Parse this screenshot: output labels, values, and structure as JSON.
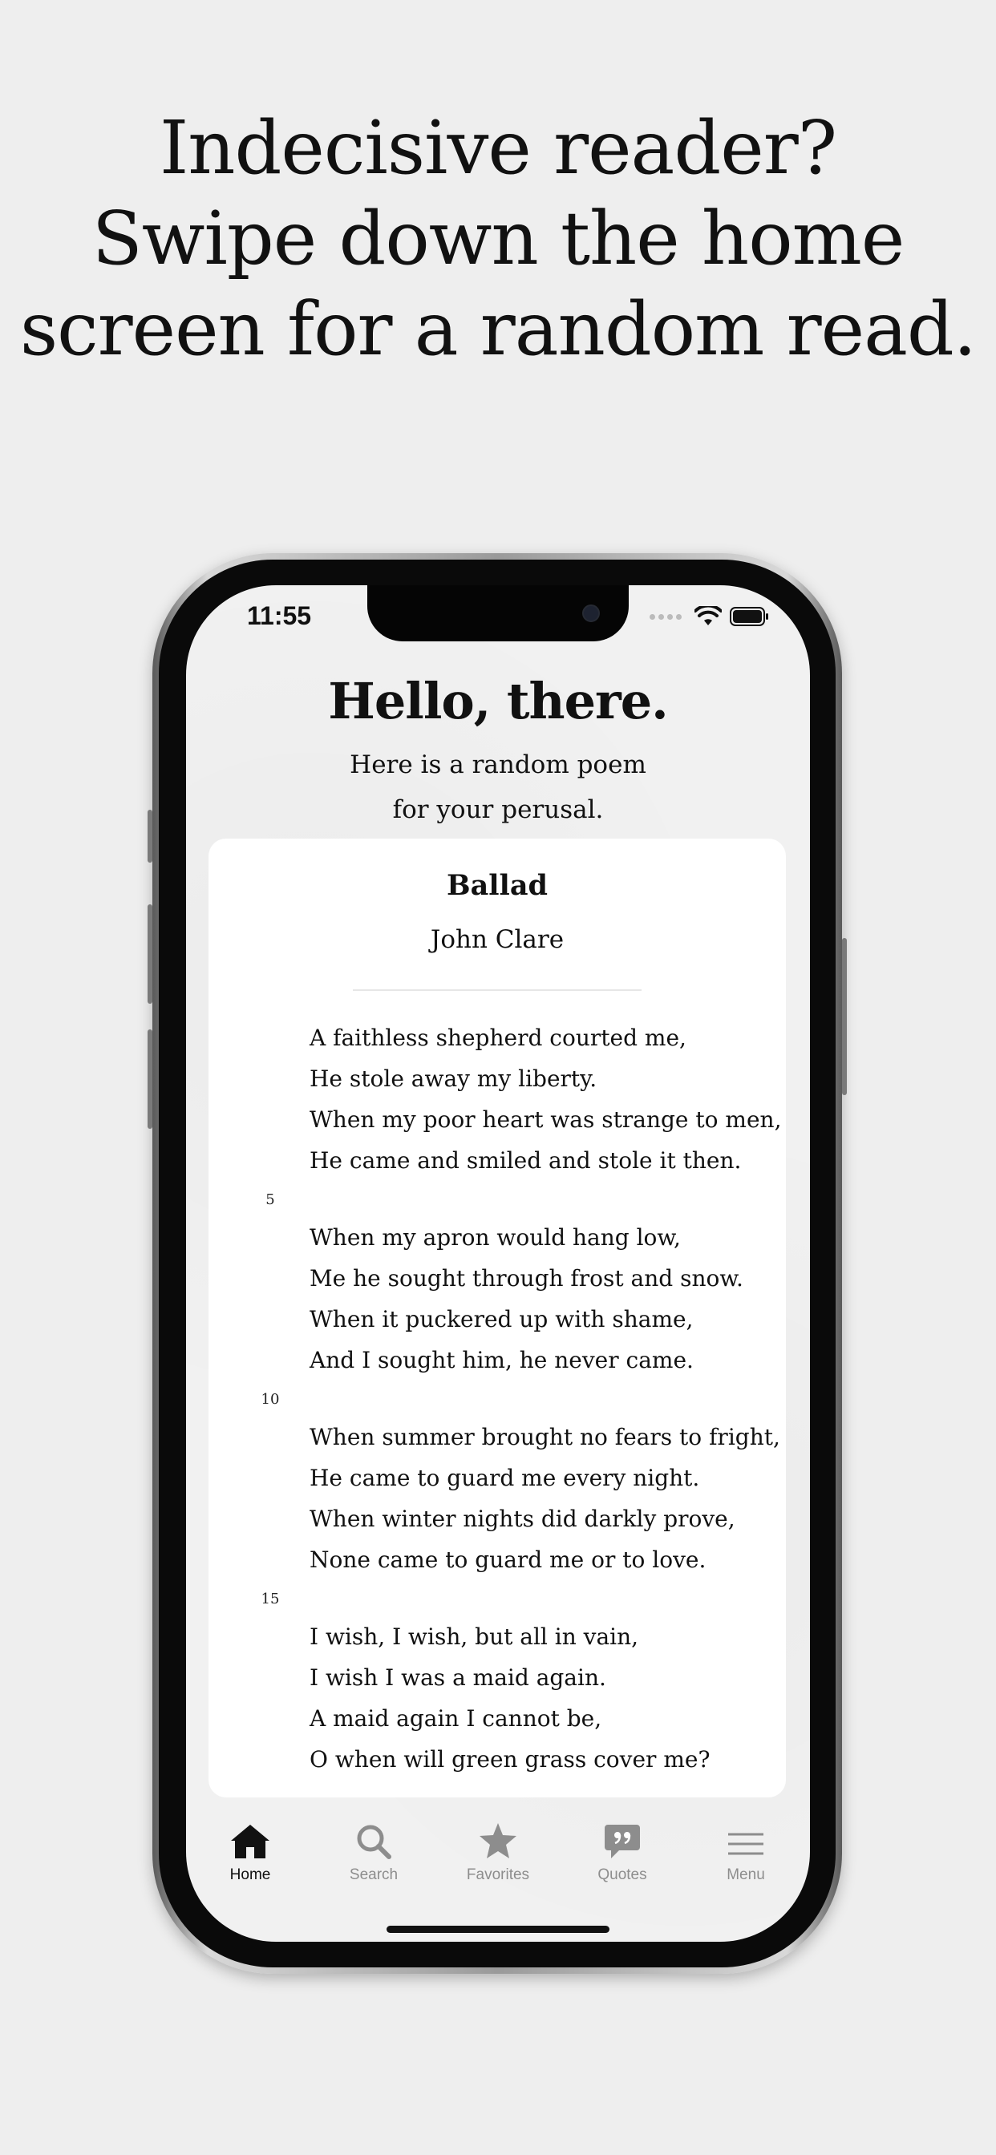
{
  "headline": {
    "line1": "Indecisive reader?",
    "line2": "Swipe down the home",
    "line3": "screen for a random read."
  },
  "status_bar": {
    "time": "11:55"
  },
  "greeting": {
    "title": "Hello, there.",
    "subtitle_line1": "Here is a random poem",
    "subtitle_line2": "for your perusal."
  },
  "poem": {
    "title": "Ballad",
    "author": "John Clare",
    "lines": [
      "A faithless shepherd courted me,",
      "He stole away my liberty.",
      "When my poor heart was strange to men,",
      "He came and smiled and stole it then.",
      "When my apron would hang low,",
      "Me he sought through frost and snow.",
      "When it puckered up with shame,",
      "And I sought him, he never came.",
      "When summer brought no fears to fright,",
      "He came to guard me every night.",
      "When winter nights did darkly prove,",
      "None came to guard me or to love.",
      "I wish, I wish, but all in vain,",
      "I wish I was a maid again.",
      "A maid again I cannot be,",
      "O when will green grass cover me?"
    ],
    "line_numbers": [
      "5",
      "10",
      "15"
    ]
  },
  "tabs": [
    {
      "label": "Home",
      "icon": "home-icon",
      "active": true
    },
    {
      "label": "Search",
      "icon": "search-icon",
      "active": false
    },
    {
      "label": "Favorites",
      "icon": "star-icon",
      "active": false
    },
    {
      "label": "Quotes",
      "icon": "quote-icon",
      "active": false
    },
    {
      "label": "Menu",
      "icon": "menu-icon",
      "active": false
    }
  ],
  "colors": {
    "background": "#eeeeee",
    "text": "#111111",
    "tab_inactive": "#8d8d8d",
    "card": "#ffffff"
  }
}
